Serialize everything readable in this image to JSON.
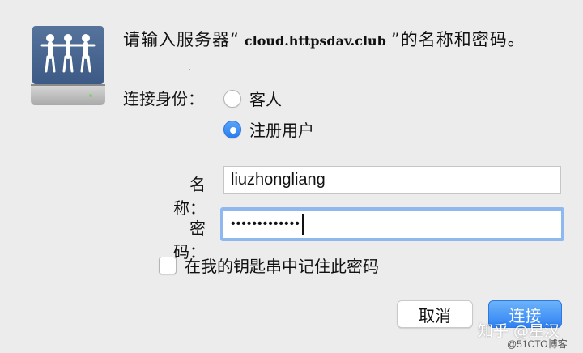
{
  "dialog": {
    "prompt_prefix": "请输入服务器“",
    "server_name": "cloud.httpsdav.club",
    "prompt_suffix": "”的名称和密码。",
    "icon": "shared-server-icon"
  },
  "connect_as": {
    "label": "连接身份：",
    "options": [
      {
        "label": "客人",
        "selected": false
      },
      {
        "label": "注册用户",
        "selected": true
      }
    ]
  },
  "fields": {
    "name_label": "名称：",
    "name_value": "liuzhongliang",
    "password_label": "密码：",
    "password_mask": "•••••••••••••"
  },
  "keychain": {
    "label": "在我的钥匙串中记住此密码",
    "checked": false
  },
  "buttons": {
    "cancel": "取消",
    "connect": "连接"
  },
  "colors": {
    "accent": "#2f82f3",
    "focus_ring": "#8fb9ee",
    "background": "#ececec"
  },
  "watermark": {
    "line1": "知乎 @星汉",
    "line2": "@51CTO博客"
  }
}
